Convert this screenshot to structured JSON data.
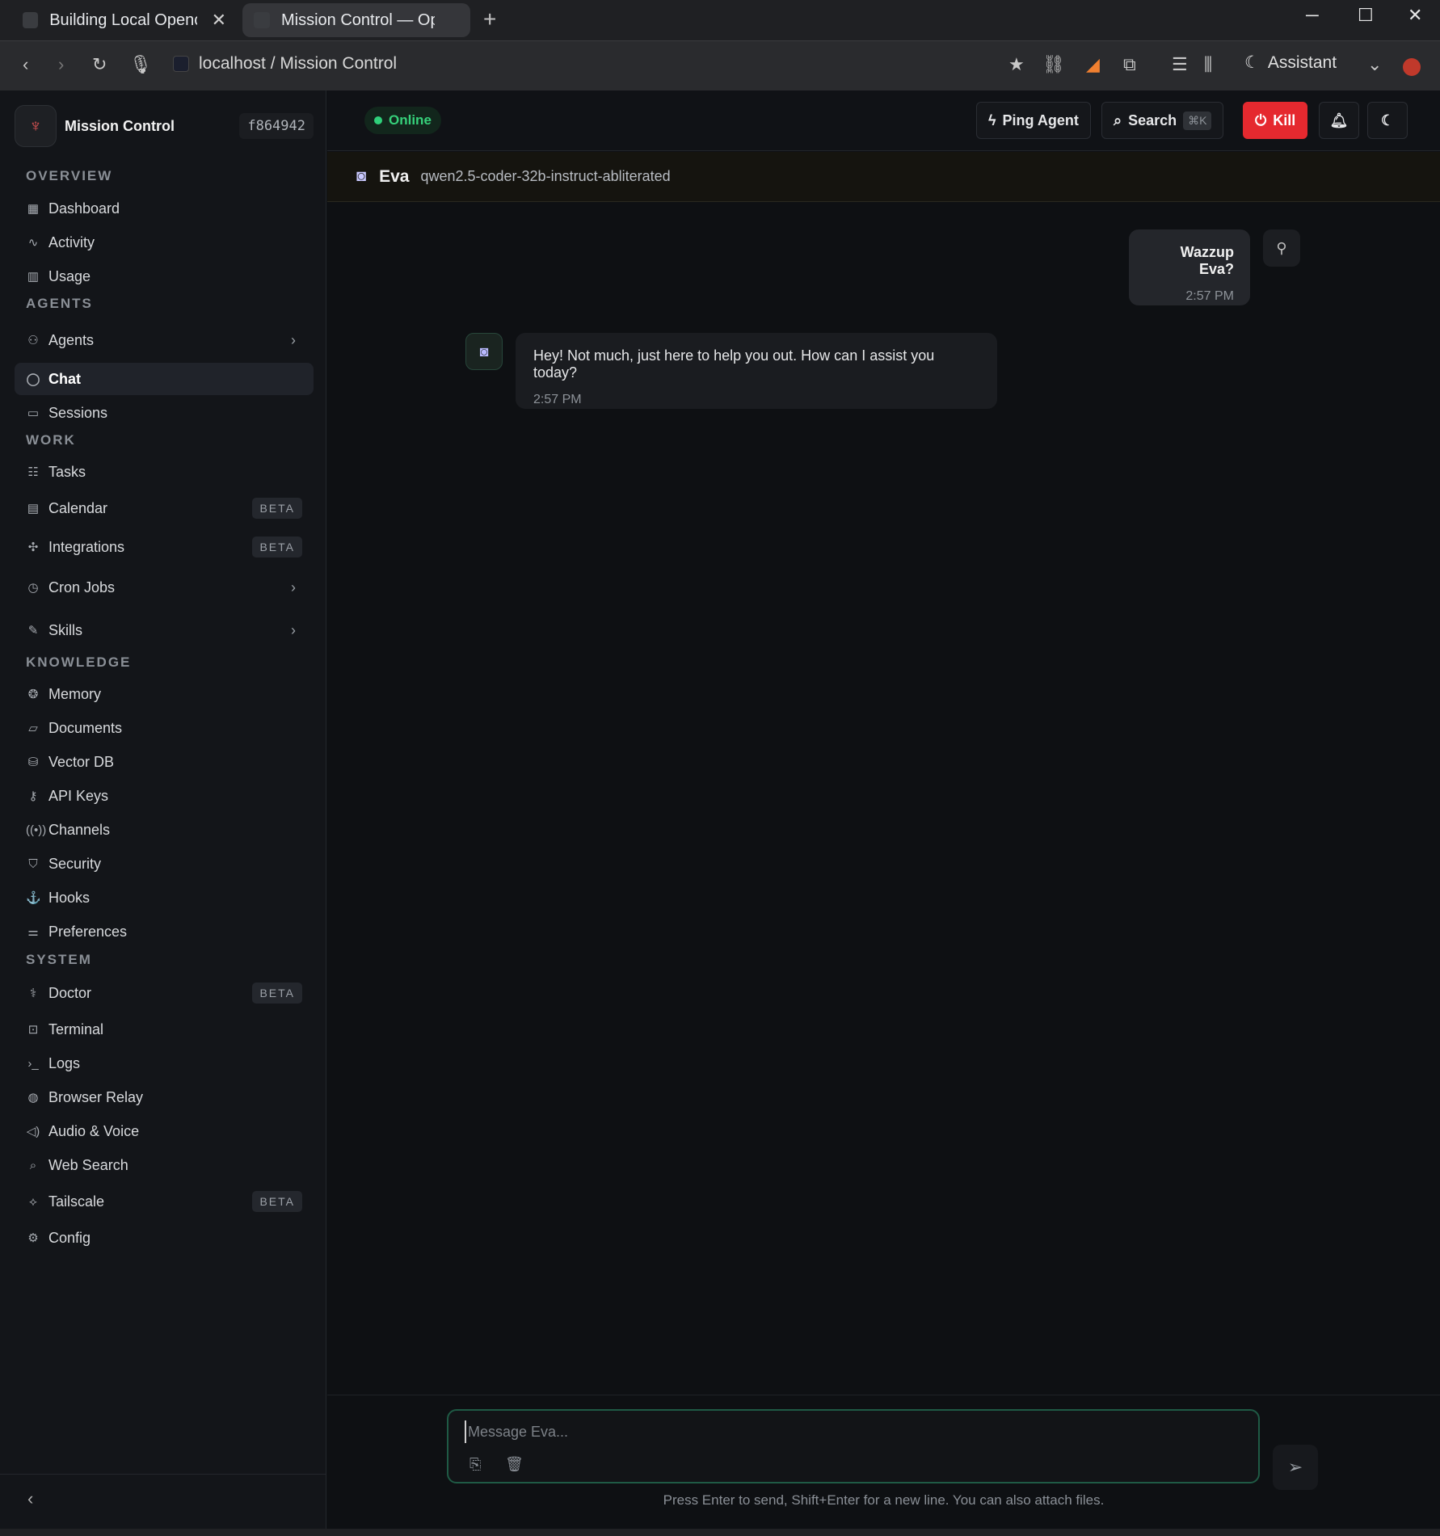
{
  "browser": {
    "tabs": [
      {
        "title": "Building Local Opencl",
        "active": false
      },
      {
        "title": "Mission Control — OpenC",
        "active": true
      }
    ],
    "address": "localhost / Mission Control",
    "assistant_label": "Assistant"
  },
  "brand": {
    "name": "Mission Control",
    "hash": "f864942"
  },
  "sidebar": {
    "sections": [
      {
        "title": "OVERVIEW"
      },
      {
        "title": "AGENTS"
      },
      {
        "title": "WORK"
      },
      {
        "title": "KNOWLEDGE"
      },
      {
        "title": "SYSTEM"
      }
    ],
    "items": [
      {
        "label": "Dashboard",
        "icon": "grid-icon"
      },
      {
        "label": "Activity",
        "icon": "pulse-icon"
      },
      {
        "label": "Usage",
        "icon": "bar-chart-icon"
      },
      {
        "label": "Agents",
        "icon": "users-icon"
      },
      {
        "label": "Chat",
        "icon": "chat-bubble-icon"
      },
      {
        "label": "Sessions",
        "icon": "message-square-icon"
      },
      {
        "label": "Tasks",
        "icon": "list-check-icon"
      },
      {
        "label": "Calendar",
        "icon": "calendar-icon",
        "badge": "BETA"
      },
      {
        "label": "Integrations",
        "icon": "puzzle-icon",
        "badge": "BETA"
      },
      {
        "label": "Cron Jobs",
        "icon": "clock-icon"
      },
      {
        "label": "Skills",
        "icon": "wrench-icon"
      },
      {
        "label": "Memory",
        "icon": "brain-icon"
      },
      {
        "label": "Documents",
        "icon": "folder-icon"
      },
      {
        "label": "Vector DB",
        "icon": "database-icon"
      },
      {
        "label": "API Keys",
        "icon": "key-icon"
      },
      {
        "label": "Channels",
        "icon": "broadcast-icon"
      },
      {
        "label": "Security",
        "icon": "shield-icon"
      },
      {
        "label": "Hooks",
        "icon": "webhook-icon"
      },
      {
        "label": "Preferences",
        "icon": "sliders-icon"
      },
      {
        "label": "Doctor",
        "icon": "stethoscope-icon",
        "badge": "BETA"
      },
      {
        "label": "Terminal",
        "icon": "terminal-square-icon"
      },
      {
        "label": "Logs",
        "icon": "terminal-prompt-icon"
      },
      {
        "label": "Browser Relay",
        "icon": "globe-icon"
      },
      {
        "label": "Audio & Voice",
        "icon": "speaker-icon"
      },
      {
        "label": "Web Search",
        "icon": "search-icon"
      },
      {
        "label": "Tailscale",
        "icon": "network-icon",
        "badge": "BETA"
      },
      {
        "label": "Config",
        "icon": "gear-icon"
      }
    ]
  },
  "header": {
    "status": "Online",
    "ping_label": "Ping Agent",
    "search_label": "Search",
    "search_shortcut": "⌘K",
    "kill_label": "Kill"
  },
  "agent": {
    "name": "Eva",
    "model": "qwen2.5-coder-32b-instruct-abliterated"
  },
  "messages": [
    {
      "role": "user",
      "text": "Wazzup Eva?",
      "time": "2:57 PM"
    },
    {
      "role": "agent",
      "text": "Hey! Not much, just here to help you out. How can I assist you today?",
      "time": "2:57 PM"
    }
  ],
  "composer": {
    "placeholder": "Message Eva...",
    "hint": "Press Enter to send, Shift+Enter for a new line. You can also attach files."
  },
  "colors": {
    "accent_green": "#2fd07a",
    "kill_red": "#e5292f",
    "composer_border": "#1f5a45"
  }
}
